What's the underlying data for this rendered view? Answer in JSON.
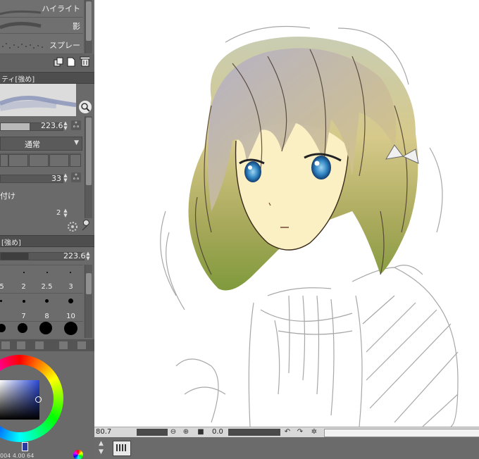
{
  "subtool_panel": {
    "items": [
      {
        "label": "ハイライト"
      },
      {
        "label": "影"
      },
      {
        "label": "スプレー"
      }
    ]
  },
  "tool_property": {
    "header": "ティ[強め]",
    "brush_size_value": "223.6",
    "blend_mode": "通常",
    "opacity_value": "33",
    "option_label": "付け",
    "count_value": "2"
  },
  "brush_size_palette": {
    "header": "[強め]",
    "size_value": "223.6",
    "row1": [
      "5",
      "2",
      "2.5",
      "3"
    ],
    "row2": [
      "7",
      "8",
      "10"
    ]
  },
  "color_wheel": {
    "footer_text": "004  4.00  64"
  },
  "status_bar": {
    "zoom_value": "80.7",
    "angle_value": "0.0"
  }
}
